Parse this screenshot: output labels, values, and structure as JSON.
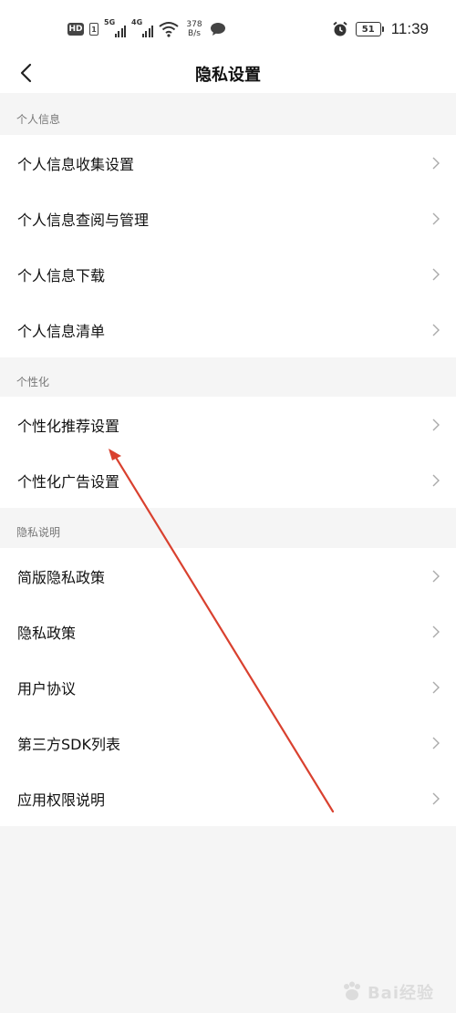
{
  "status_bar": {
    "hd": "HD",
    "sim": "1",
    "net1": "5G",
    "net2": "4G",
    "speed_value": "378",
    "speed_unit": "B/s",
    "battery": "51",
    "time": "11:39"
  },
  "header": {
    "title": "隐私设置"
  },
  "sections": [
    {
      "title": "个人信息",
      "items": [
        "个人信息收集设置",
        "个人信息查阅与管理",
        "个人信息下载",
        "个人信息清单"
      ]
    },
    {
      "title": "个性化",
      "items": [
        "个性化推荐设置",
        "个性化广告设置"
      ]
    },
    {
      "title": "隐私说明",
      "items": [
        "简版隐私政策",
        "隐私政策",
        "用户协议",
        "第三方SDK列表",
        "应用权限说明"
      ]
    }
  ],
  "annotation_color": "#d9412f",
  "watermark": {
    "text": "Bai经验"
  }
}
